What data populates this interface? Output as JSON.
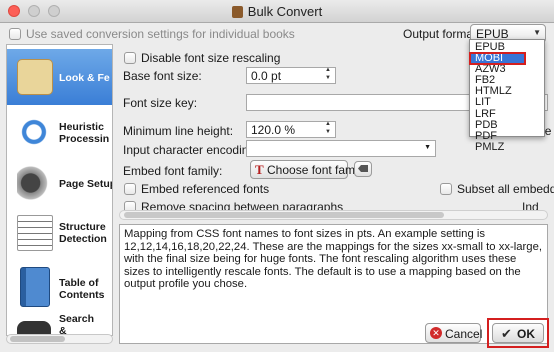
{
  "window": {
    "title": "Bulk Convert"
  },
  "top": {
    "use_saved_label": "Use saved conversion settings for individual books",
    "output_format_label": "Output format:",
    "output_format_value": "EPUB"
  },
  "format_options": [
    "EPUB",
    "MOBI",
    "AZW3",
    "FB2",
    "HTMLZ",
    "LIT",
    "LRF",
    "PDB",
    "PDF",
    "PMLZ"
  ],
  "selected_format": "MOBI",
  "sidebar": {
    "items": [
      {
        "label": "Look & Fe",
        "icon": "look-and-feel-icon"
      },
      {
        "label": "Heuristic Processin",
        "icon": "heuristic-processing-icon"
      },
      {
        "label": "Page Setup",
        "icon": "page-setup-icon"
      },
      {
        "label": "Structure Detection",
        "icon": "structure-detection-icon"
      },
      {
        "label": "Table of Contents",
        "icon": "table-of-contents-icon"
      },
      {
        "label": "Search & Replace",
        "icon": "search-replace-icon"
      }
    ]
  },
  "form": {
    "disable_rescaling": "Disable font size rescaling",
    "base_font_size_label": "Base font size:",
    "base_font_size_value": "0.0 pt",
    "font_size_key_label": "Font size key:",
    "font_size_key_value": "",
    "min_line_height_label": "Minimum line height:",
    "min_line_height_value": "120.0 %",
    "line_height_label": "Line he",
    "input_encoding_label": "Input character encoding:",
    "input_encoding_value": "",
    "embed_font_label": "Embed font family:",
    "choose_font_button": "Choose font family",
    "embed_referenced": "Embed referenced fonts",
    "subset_all": "Subset all embedd",
    "remove_spacing": "Remove spacing between paragraphs",
    "ind_label": "Ind"
  },
  "description": "Mapping from CSS font names to font sizes in pts. An example setting is 12,12,14,16,18,20,22,24. These are the mappings for the sizes xx-small to xx-large, with the final size being for huge fonts. The font rescaling algorithm uses these sizes to intelligently rescale fonts. The default is to use a mapping based on the output profile you chose.",
  "footer": {
    "cancel_label": "Cancel",
    "ok_label": "OK"
  },
  "colors": {
    "highlight": "#3875d7",
    "annotation": "#d41f1f"
  }
}
